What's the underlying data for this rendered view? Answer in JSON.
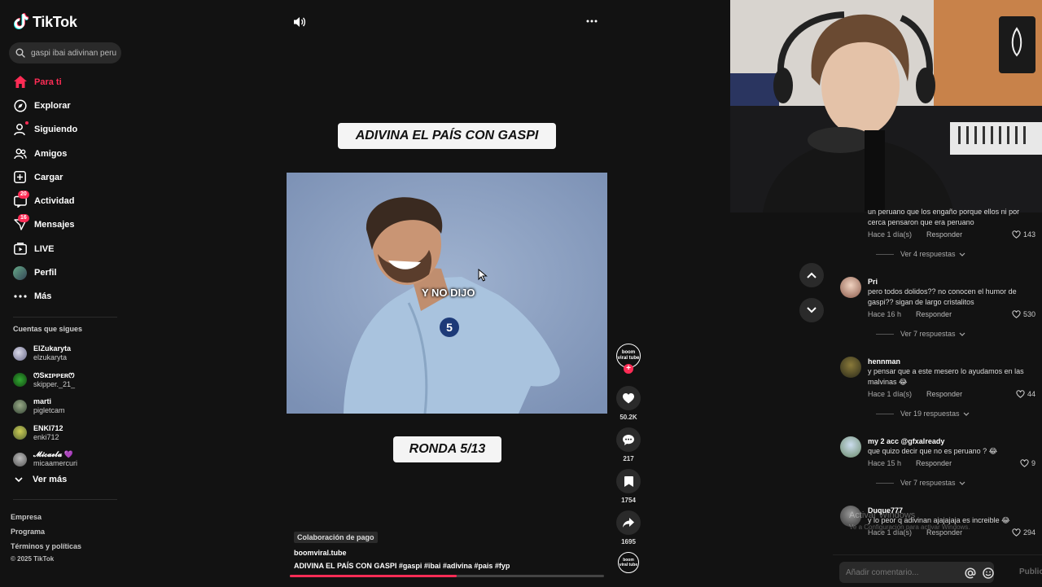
{
  "app": {
    "logo_text": "TikTok"
  },
  "search": {
    "value": "gaspi ibai adivinan peru"
  },
  "nav": [
    {
      "label": "Para ti",
      "icon": "home-icon",
      "active": true
    },
    {
      "label": "Explorar",
      "icon": "compass-icon"
    },
    {
      "label": "Siguiendo",
      "icon": "following-icon"
    },
    {
      "label": "Amigos",
      "icon": "friends-icon"
    },
    {
      "label": "Cargar",
      "icon": "upload-icon"
    },
    {
      "label": "Actividad",
      "icon": "activity-icon",
      "badge": "20"
    },
    {
      "label": "Mensajes",
      "icon": "messages-icon",
      "badge": "16"
    },
    {
      "label": "LIVE",
      "icon": "live-icon"
    },
    {
      "label": "Perfil",
      "icon": "profile-avatar"
    },
    {
      "label": "Más",
      "icon": "more-icon"
    }
  ],
  "following": {
    "title": "Cuentas que sigues",
    "accounts": [
      {
        "name": "ElZukaryta",
        "user": "elzukaryta"
      },
      {
        "name": "&#x1F5B5;&#x24C8;ᴋɪᴘᴘᴇʀ&#x1F5B5;",
        "user": "skipper._21_"
      },
      {
        "name": "marti",
        "user": "pigletcam"
      },
      {
        "name": "ENKI712",
        "user": "enki712"
      },
      {
        "name": "𝓜𝓲𝓬𝓪𝓮𝓵𝓪 💜",
        "user": "micaamercuri"
      }
    ],
    "more_label": "Ver más"
  },
  "footer": {
    "links": [
      "Empresa",
      "Programa",
      "Términos y políticas"
    ],
    "copyright": "© 2025 TikTok"
  },
  "video": {
    "title_overlay": "ADIVINA EL PAÍS CON GASPI",
    "subtitle_overlay": "Y NO DIJO",
    "round_overlay": "RONDA 5/13",
    "paid_label": "Colaboración de pago",
    "author": "boomviral.tube",
    "description": "ADIVINA EL PAÍS CON GASPI #gaspi #ibai #adivina #pais #fyp",
    "progress": 0.53
  },
  "rail": {
    "avatar_text": "boom viral tube",
    "likes": "50.2K",
    "comments": "217",
    "saves": "1754",
    "shares": "1695"
  },
  "comments": [
    {
      "user": "",
      "text": "un peruano que los engaño porque ellos ni por cerca pensaron que era peruano",
      "time": "Hace 1 día(s)",
      "reply": "Responder",
      "likes": "143",
      "replies": "Ver 4 respuestas"
    },
    {
      "user": "Pri",
      "text": "pero todos dolidos?? no conocen el humor de gaspi?? sigan de largo cristalitos",
      "time": "Hace 16 h",
      "reply": "Responder",
      "likes": "530",
      "replies": "Ver 7 respuestas"
    },
    {
      "user": "hennman",
      "text": "y pensar que a este mesero lo ayudamos en las malvinas 😂",
      "time": "Hace 1 día(s)",
      "reply": "Responder",
      "likes": "44",
      "replies": "Ver 19 respuestas"
    },
    {
      "user": "my 2 acc @gfxalready",
      "text": "que quizo decir que no es peruano ? 😂",
      "time": "Hace 15 h",
      "reply": "Responder",
      "likes": "9",
      "replies": "Ver 7 respuestas"
    },
    {
      "user": "Duque777",
      "text": "y lo peor q adivinan ajajajaja es increible 😂",
      "time": "Hace 1 día(s)",
      "reply": "Responder",
      "likes": "294",
      "replies": ""
    }
  ],
  "comment_input": {
    "placeholder": "Añadir comentario...",
    "publish": "Publicar"
  },
  "watermark": {
    "title": "Activar Windows",
    "subtitle": "Ve a Configuración para activar Windows."
  },
  "colors": {
    "accent": "#fe2c55",
    "background": "#121212"
  }
}
